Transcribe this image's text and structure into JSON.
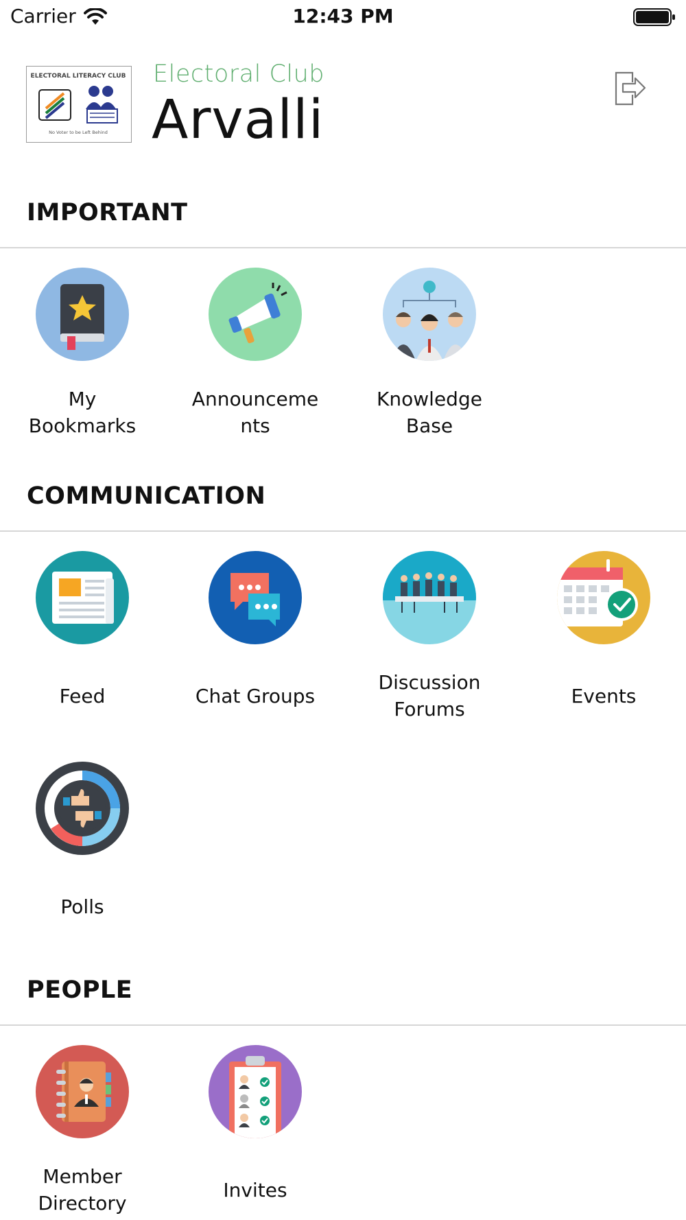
{
  "status_bar": {
    "carrier": "Carrier",
    "time": "12:43 PM"
  },
  "header": {
    "logo": {
      "title": "ELECTORAL LITERACY CLUB",
      "tagline": "No Voter to be Left Behind",
      "icon": "electoral-club-logo"
    },
    "subtitle": "Electoral Club",
    "title": "Arvalli",
    "logout_icon": "logout-icon"
  },
  "colors": {
    "accent_green": "#5fae6f",
    "divider": "#d6d6d6"
  },
  "sections": [
    {
      "title": "IMPORTANT",
      "items": [
        {
          "label": "My\nBookmarks",
          "icon": "bookmark-book-icon",
          "bg": "#8fb8e3"
        },
        {
          "label": "Announceme\nnts",
          "icon": "megaphone-icon",
          "bg": "#8fdcab"
        },
        {
          "label": "Knowledge\nBase",
          "icon": "team-idea-icon",
          "bg": "#bcdaf3"
        }
      ]
    },
    {
      "title": "COMMUNICATION",
      "items": [
        {
          "label": "Feed",
          "icon": "newspaper-icon",
          "bg": "#1a9aa2"
        },
        {
          "label": "Chat Groups",
          "icon": "chat-bubbles-icon",
          "bg": "#125fb2"
        },
        {
          "label": "Discussion\nForums",
          "icon": "meeting-table-icon",
          "bg": "#86d6e4"
        },
        {
          "label": "Events",
          "icon": "calendar-check-icon",
          "bg": "#e8b43a"
        },
        {
          "label": "Polls",
          "icon": "thumbs-poll-icon",
          "bg": "#3b4047"
        }
      ]
    },
    {
      "title": "PEOPLE",
      "items": [
        {
          "label": "Member\nDirectory",
          "icon": "address-book-icon",
          "bg": "#d35a54"
        },
        {
          "label": "Invites",
          "icon": "invite-clipboard-icon",
          "bg": "#9a6ec9"
        }
      ]
    }
  ]
}
